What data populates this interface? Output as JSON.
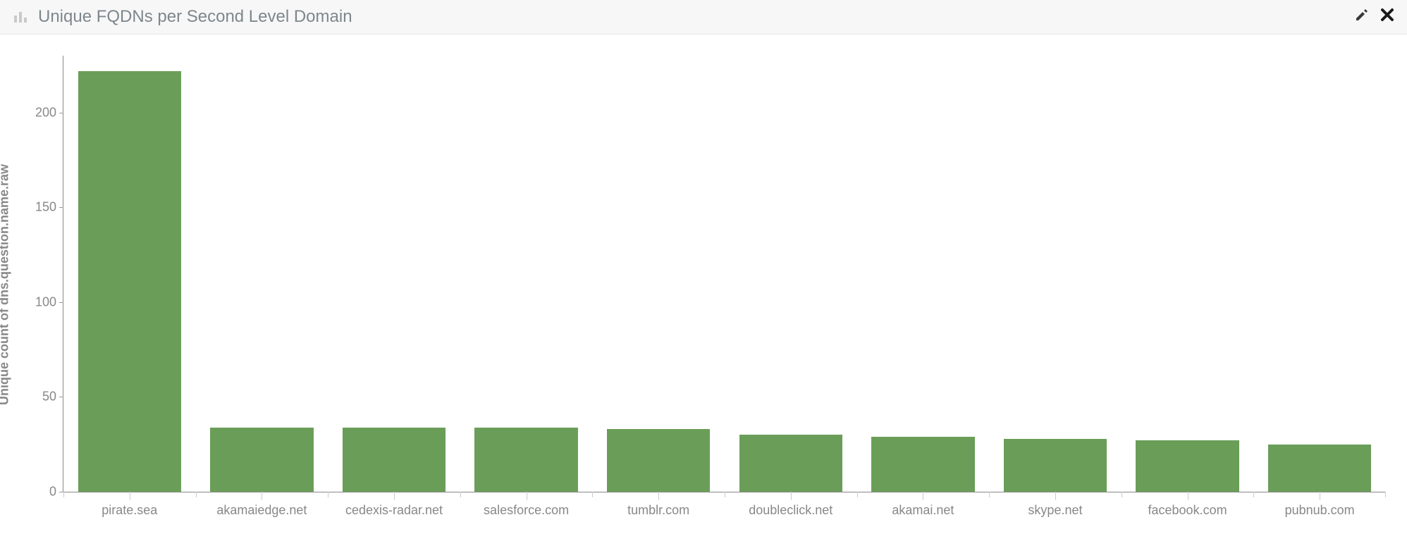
{
  "panel": {
    "title": "Unique FQDNs per Second Level Domain",
    "icons": {
      "chart": "bar-chart-icon",
      "edit": "pencil-icon",
      "close": "close-icon"
    }
  },
  "chart_data": {
    "type": "bar",
    "title": "Unique FQDNs per Second Level Domain",
    "xlabel": "",
    "ylabel": "Unique count of dns.question.name.raw",
    "ylim": [
      0,
      230
    ],
    "yticks": [
      0,
      50,
      100,
      150,
      200
    ],
    "categories": [
      "pirate.sea",
      "akamaiedge.net",
      "cedexis-radar.net",
      "salesforce.com",
      "tumblr.com",
      "doubleclick.net",
      "akamai.net",
      "skype.net",
      "facebook.com",
      "pubnub.com"
    ],
    "values": [
      222,
      34,
      34,
      34,
      33,
      30,
      29,
      28,
      27,
      25
    ],
    "color": "#6a9e58"
  }
}
